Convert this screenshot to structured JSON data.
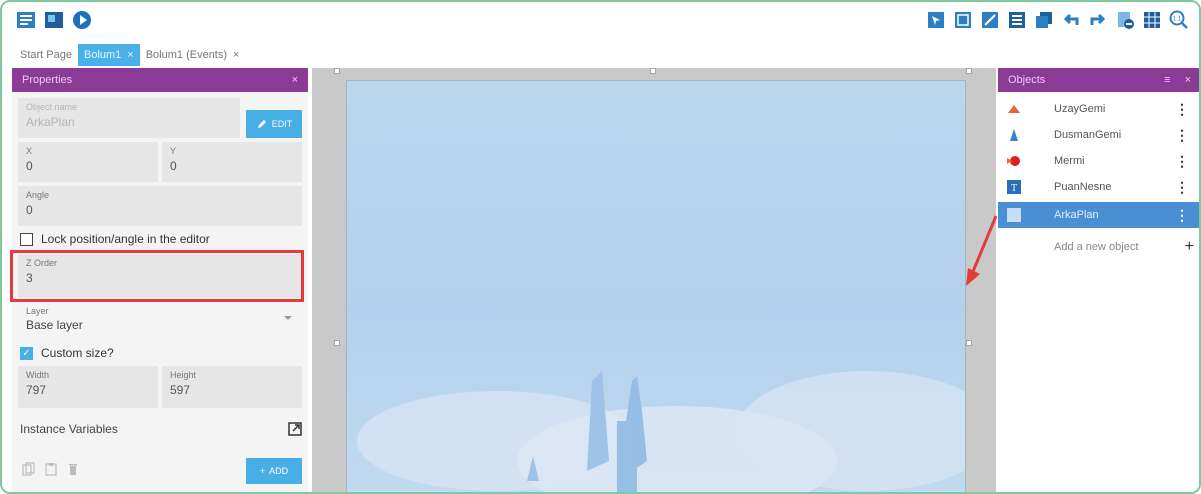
{
  "tabs": [
    {
      "label": "Start Page",
      "active": false,
      "closable": false
    },
    {
      "label": "Bolum1",
      "active": true,
      "closable": true
    },
    {
      "label": "Bolum1 (Events)",
      "active": false,
      "closable": true
    }
  ],
  "tab_close_glyph": "×",
  "properties": {
    "title": "Properties",
    "close": "×",
    "object_name": {
      "label": "Object name",
      "value": "ArkaPlan"
    },
    "edit_label": "EDIT",
    "x": {
      "label": "X",
      "value": "0"
    },
    "y": {
      "label": "Y",
      "value": "0"
    },
    "angle": {
      "label": "Angle",
      "value": "0"
    },
    "lock_label": "Lock position/angle in the editor",
    "zorder": {
      "label": "Z Order",
      "value": "3"
    },
    "layer": {
      "label": "Layer",
      "value": "Base layer"
    },
    "custom_size_label": "Custom size?",
    "width": {
      "label": "Width",
      "value": "797"
    },
    "height": {
      "label": "Height",
      "value": "597"
    },
    "instance_variables_label": "Instance Variables",
    "add_label": "ADD"
  },
  "objects": {
    "title": "Objects",
    "close": "×",
    "items": [
      {
        "name": "UzayGemi",
        "icon": "spaceship-icon"
      },
      {
        "name": "DusmanGemi",
        "icon": "enemy-ship-icon"
      },
      {
        "name": "Mermi",
        "icon": "bullet-icon"
      },
      {
        "name": "PuanNesne",
        "icon": "text-object-icon"
      },
      {
        "name": "ArkaPlan",
        "icon": "background-icon"
      }
    ],
    "selected_index": 4,
    "add_label": "Add a new object",
    "menu_glyph": "⋮"
  },
  "colors": {
    "panel_header": "#8b3a96",
    "accent_blue": "#47aee6",
    "selected_row": "#4a8fd4",
    "highlight_red": "#e23b3b"
  }
}
